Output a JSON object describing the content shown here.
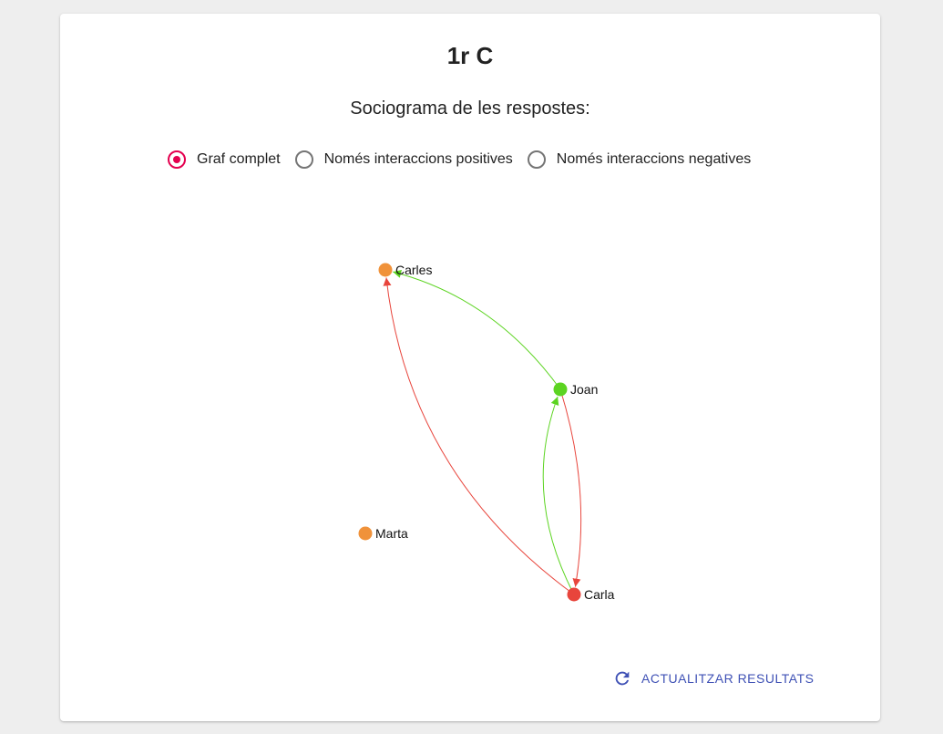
{
  "page": {
    "title": "1r C",
    "subtitle": "Sociograma de les respostes:"
  },
  "view_options": {
    "selected": "Graf complet",
    "items": [
      {
        "label": "Graf complet",
        "checked": true
      },
      {
        "label": "Només interaccions positives",
        "checked": false
      },
      {
        "label": "Només interaccions negatives",
        "checked": false
      }
    ]
  },
  "colors": {
    "accent": "#e4004f",
    "positive": "#5cd421",
    "negative": "#e8453c",
    "neutral_node": "#f0923a",
    "button": "#3f51b5"
  },
  "graph": {
    "nodes": [
      {
        "id": "Carles",
        "label": "Carles",
        "color": "#f0923a"
      },
      {
        "id": "Joan",
        "label": "Joan",
        "color": "#5cd421"
      },
      {
        "id": "Marta",
        "label": "Marta",
        "color": "#f0923a"
      },
      {
        "id": "Carla",
        "label": "Carla",
        "color": "#e8453c"
      }
    ],
    "edges": [
      {
        "from": "Joan",
        "to": "Carles",
        "type": "positive"
      },
      {
        "from": "Carla",
        "to": "Carles",
        "type": "negative"
      },
      {
        "from": "Carla",
        "to": "Joan",
        "type": "positive"
      },
      {
        "from": "Joan",
        "to": "Carla",
        "type": "negative"
      }
    ]
  },
  "actions": {
    "refresh_label": "ACTUALITZAR RESULTATS",
    "refresh_icon": "refresh-icon"
  }
}
